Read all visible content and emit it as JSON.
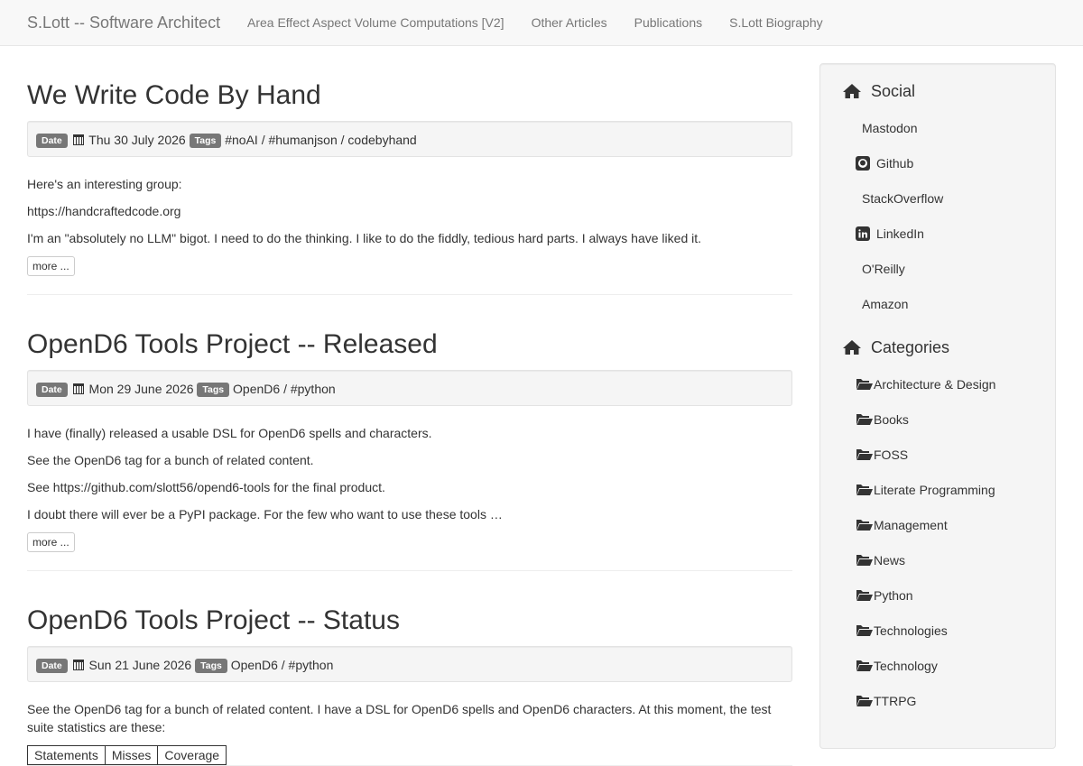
{
  "navbar": {
    "brand": "S.Lott -- Software Architect",
    "links": [
      "Area Effect Aspect Volume Computations [V2]",
      "Other Articles",
      "Publications",
      "S.Lott Biography"
    ]
  },
  "labels": {
    "date": "Date",
    "tags": "Tags",
    "more": "more ..."
  },
  "articles": [
    {
      "title": "We Write Code By Hand",
      "date": "Thu 30 July 2026",
      "tags": "#noAI / #humanjson / codebyhand",
      "paragraphs": [
        "Here's an interesting group:",
        "https://handcraftedcode.org",
        "I'm an \"absolutely no LLM\" bigot. I need to do the thinking. I like to do the fiddly, tedious hard parts. I always have liked it."
      ]
    },
    {
      "title": "OpenD6 Tools Project -- Released",
      "date": "Mon 29 June 2026",
      "tags": "OpenD6 / #python",
      "paragraphs": [
        "I have (finally) released a usable DSL for OpenD6 spells and characters.",
        "See the OpenD6 tag for a bunch of related content.",
        "See https://github.com/slott56/opend6-tools for the final product.",
        "I doubt there will ever be a PyPI package. For the few who want to use these tools …"
      ]
    },
    {
      "title": "OpenD6 Tools Project -- Status",
      "date": "Sun 21 June 2026",
      "tags": "OpenD6 / #python",
      "paragraphs": [
        "See the OpenD6 tag for a bunch of related content. I have a DSL for OpenD6 spells and OpenD6 characters. At this moment, the test suite statistics are these:"
      ],
      "table_headers": [
        "Statements",
        "Misses",
        "Coverage"
      ]
    }
  ],
  "sidebar": {
    "social_title": "Social",
    "social": [
      "Mastodon",
      "Github",
      "StackOverflow",
      "LinkedIn",
      "O'Reilly",
      "Amazon"
    ],
    "categories_title": "Categories",
    "categories": [
      "Architecture & Design",
      "Books",
      "FOSS",
      "Literate Programming",
      "Management",
      "News",
      "Python",
      "Technologies",
      "Technology",
      "TTRPG"
    ]
  }
}
